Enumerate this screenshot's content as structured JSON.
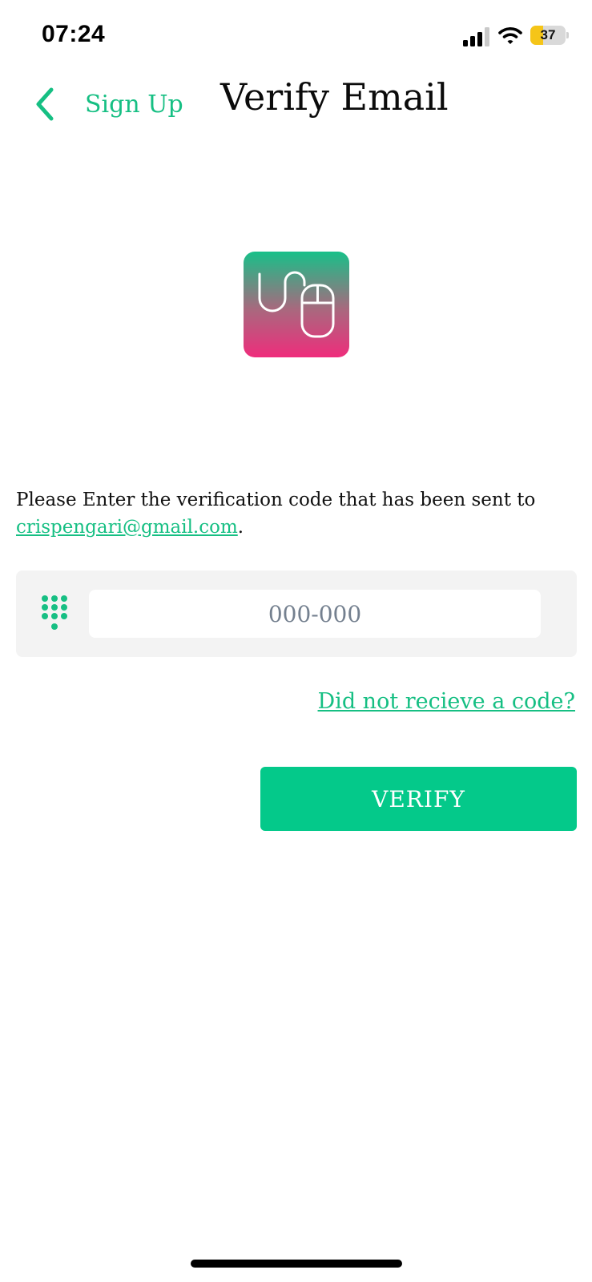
{
  "status_bar": {
    "time": "07:24",
    "battery_level": "37",
    "battery_fraction": 0.37,
    "signal_icon": "cellular-signal-icon",
    "wifi_icon": "wifi-icon",
    "battery_icon": "battery-charging-icon"
  },
  "nav": {
    "back_icon": "chevron-left-icon",
    "back_label": "Sign Up",
    "title": "Verify Email"
  },
  "logo": {
    "icon": "computer-mouse-cable-icon",
    "colors": [
      "#18c089",
      "#ef2d7c"
    ]
  },
  "instructions": {
    "text": "Please Enter the verification code that has been sent to",
    "email": "crispengari@gmail.com",
    "suffix": "."
  },
  "code_field": {
    "icon": "dialpad-icon",
    "placeholder": "000-000",
    "value": ""
  },
  "resend_link": "Did not recieve a code?",
  "verify_button": "VERIFY",
  "colors": {
    "accent": "#16bf83",
    "button": "#04c98a",
    "panel": "#f3f3f3"
  }
}
